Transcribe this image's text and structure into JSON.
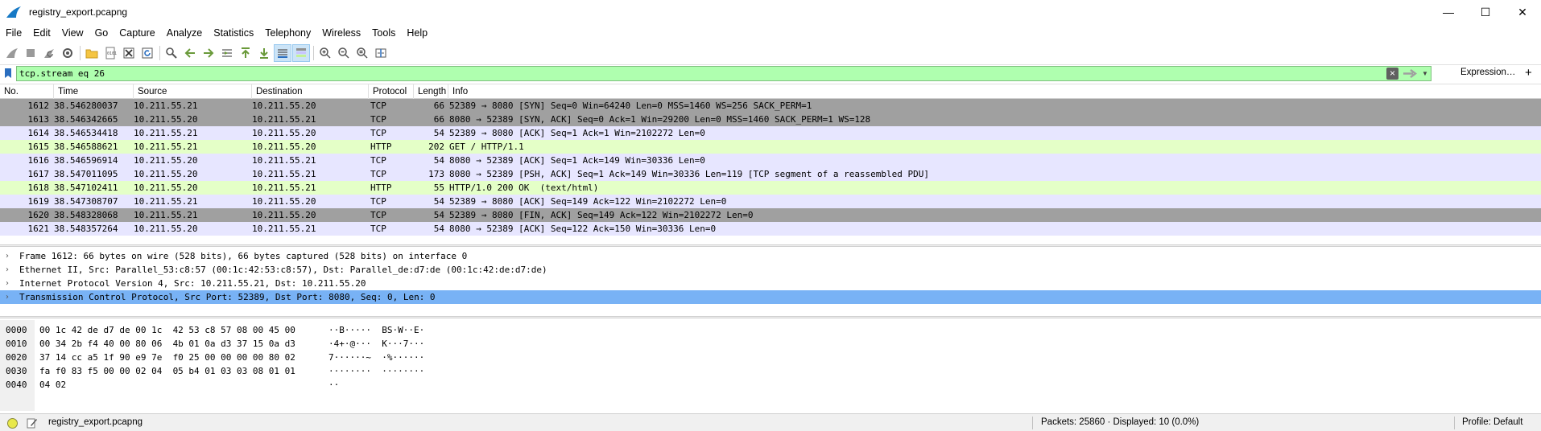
{
  "window": {
    "title": "registry_export.pcapng",
    "minimize": "—",
    "maximize": "☐",
    "close": "✕"
  },
  "menu": [
    "File",
    "Edit",
    "View",
    "Go",
    "Capture",
    "Analyze",
    "Statistics",
    "Telephony",
    "Wireless",
    "Tools",
    "Help"
  ],
  "filter": {
    "value": "tcp.stream eq 26",
    "expression_label": "Expression…",
    "plus_label": "+"
  },
  "columns": {
    "no": "No.",
    "time": "Time",
    "source": "Source",
    "destination": "Destination",
    "protocol": "Protocol",
    "length": "Length",
    "info": "Info"
  },
  "packets": [
    {
      "no": "1612",
      "time": "38.546280037",
      "source": "10.211.55.21",
      "destination": "10.211.55.20",
      "protocol": "TCP",
      "length": "66",
      "info": "52389 → 8080 [SYN] Seq=0 Win=64240 Len=0 MSS=1460 WS=256 SACK_PERM=1",
      "style": "syn"
    },
    {
      "no": "1613",
      "time": "38.546342665",
      "source": "10.211.55.20",
      "destination": "10.211.55.21",
      "protocol": "TCP",
      "length": "66",
      "info": "8080 → 52389 [SYN, ACK] Seq=0 Ack=1 Win=29200 Len=0 MSS=1460 SACK_PERM=1 WS=128",
      "style": "syn"
    },
    {
      "no": "1614",
      "time": "38.546534418",
      "source": "10.211.55.21",
      "destination": "10.211.55.20",
      "protocol": "TCP",
      "length": "54",
      "info": "52389 → 8080 [ACK] Seq=1 Ack=1 Win=2102272 Len=0",
      "style": "tcp"
    },
    {
      "no": "1615",
      "time": "38.546588621",
      "source": "10.211.55.21",
      "destination": "10.211.55.20",
      "protocol": "HTTP",
      "length": "202",
      "info": "GET / HTTP/1.1",
      "style": "http"
    },
    {
      "no": "1616",
      "time": "38.546596914",
      "source": "10.211.55.20",
      "destination": "10.211.55.21",
      "protocol": "TCP",
      "length": "54",
      "info": "8080 → 52389 [ACK] Seq=1 Ack=149 Win=30336 Len=0",
      "style": "tcp"
    },
    {
      "no": "1617",
      "time": "38.547011095",
      "source": "10.211.55.20",
      "destination": "10.211.55.21",
      "protocol": "TCP",
      "length": "173",
      "info": "8080 → 52389 [PSH, ACK] Seq=1 Ack=149 Win=30336 Len=119 [TCP segment of a reassembled PDU]",
      "style": "tcp"
    },
    {
      "no": "1618",
      "time": "38.547102411",
      "source": "10.211.55.20",
      "destination": "10.211.55.21",
      "protocol": "HTTP",
      "length": "55",
      "info": "HTTP/1.0 200 OK  (text/html)",
      "style": "http"
    },
    {
      "no": "1619",
      "time": "38.547308707",
      "source": "10.211.55.21",
      "destination": "10.211.55.20",
      "protocol": "TCP",
      "length": "54",
      "info": "52389 → 8080 [ACK] Seq=149 Ack=122 Win=2102272 Len=0",
      "style": "tcp"
    },
    {
      "no": "1620",
      "time": "38.548328068",
      "source": "10.211.55.21",
      "destination": "10.211.55.20",
      "protocol": "TCP",
      "length": "54",
      "info": "52389 → 8080 [FIN, ACK] Seq=149 Ack=122 Win=2102272 Len=0",
      "style": "fin"
    },
    {
      "no": "1621",
      "time": "38.548357264",
      "source": "10.211.55.20",
      "destination": "10.211.55.21",
      "protocol": "TCP",
      "length": "54",
      "info": "8080 → 52389 [ACK] Seq=122 Ack=150 Win=30336 Len=0",
      "style": "tcp"
    }
  ],
  "details": [
    {
      "text": "Frame 1612: 66 bytes on wire (528 bits), 66 bytes captured (528 bits) on interface 0",
      "selected": false
    },
    {
      "text": "Ethernet II, Src: Parallel_53:c8:57 (00:1c:42:53:c8:57), Dst: Parallel_de:d7:de (00:1c:42:de:d7:de)",
      "selected": false
    },
    {
      "text": "Internet Protocol Version 4, Src: 10.211.55.21, Dst: 10.211.55.20",
      "selected": false
    },
    {
      "text": "Transmission Control Protocol, Src Port: 52389, Dst Port: 8080, Seq: 0, Len: 0",
      "selected": true
    }
  ],
  "bytes": [
    {
      "offset": "0000",
      "hex": "00 1c 42 de d7 de 00 1c  42 53 c8 57 08 00 45 00",
      "ascii": "··B·····  BS·W··E·"
    },
    {
      "offset": "0010",
      "hex": "00 34 2b f4 40 00 80 06  4b 01 0a d3 37 15 0a d3",
      "ascii": "·4+·@···  K···7···"
    },
    {
      "offset": "0020",
      "hex": "37 14 cc a5 1f 90 e9 7e  f0 25 00 00 00 00 80 02",
      "ascii": "7······~  ·%······"
    },
    {
      "offset": "0030",
      "hex": "fa f0 83 f5 00 00 02 04  05 b4 01 03 03 08 01 01",
      "ascii": "········  ········"
    },
    {
      "offset": "0040",
      "hex": "04 02",
      "ascii": "··"
    }
  ],
  "status": {
    "file": "registry_export.pcapng",
    "packets": "Packets: 25860 · Displayed: 10 (0.0%)",
    "profile": "Profile: Default"
  },
  "icons": {
    "app": "wireshark-fin-icon",
    "bookmark": "bookmark-icon",
    "clear": "clear-filter-icon",
    "apply": "apply-filter-arrow-icon"
  }
}
